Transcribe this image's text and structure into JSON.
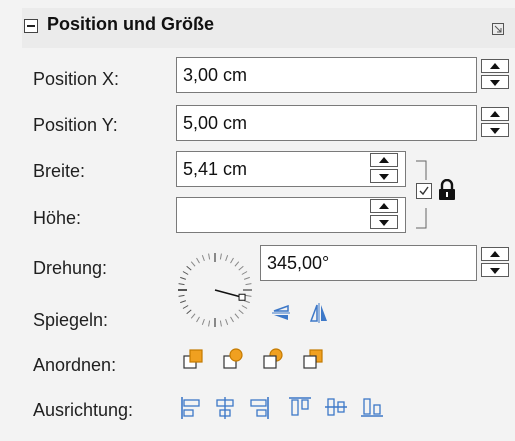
{
  "section": {
    "title": "Position und Größe"
  },
  "position_x": {
    "label": "Position X:",
    "value": "3,00 cm"
  },
  "position_y": {
    "label": "Position Y:",
    "value": "5,00 cm"
  },
  "width": {
    "label": "Breite:",
    "value": "5,41 cm"
  },
  "height": {
    "label": "Höhe:",
    "value": ""
  },
  "rotation": {
    "label": "Drehung:",
    "value": "345,00°"
  },
  "flip": {
    "label": "Spiegeln:"
  },
  "arrange": {
    "label": "Anordnen:"
  },
  "align": {
    "label": "Ausrichtung:"
  },
  "keep_ratio": {
    "checked": true
  },
  "colors": {
    "accent_orange": "#f0a020",
    "accent_blue": "#3d78c8",
    "panel_bg": "#f3f3f3",
    "header_bg": "#ebebeb"
  },
  "icons": [
    "collapse-icon",
    "more-options-icon",
    "lock-icon",
    "rotation-dial-icon",
    "flip-vertical-icon",
    "flip-horizontal-icon",
    "bring-to-front-icon",
    "bring-forward-icon",
    "send-backward-icon",
    "send-to-back-icon",
    "align-left-icon",
    "align-center-icon",
    "align-right-icon",
    "align-top-icon",
    "align-middle-icon",
    "align-bottom-icon"
  ]
}
